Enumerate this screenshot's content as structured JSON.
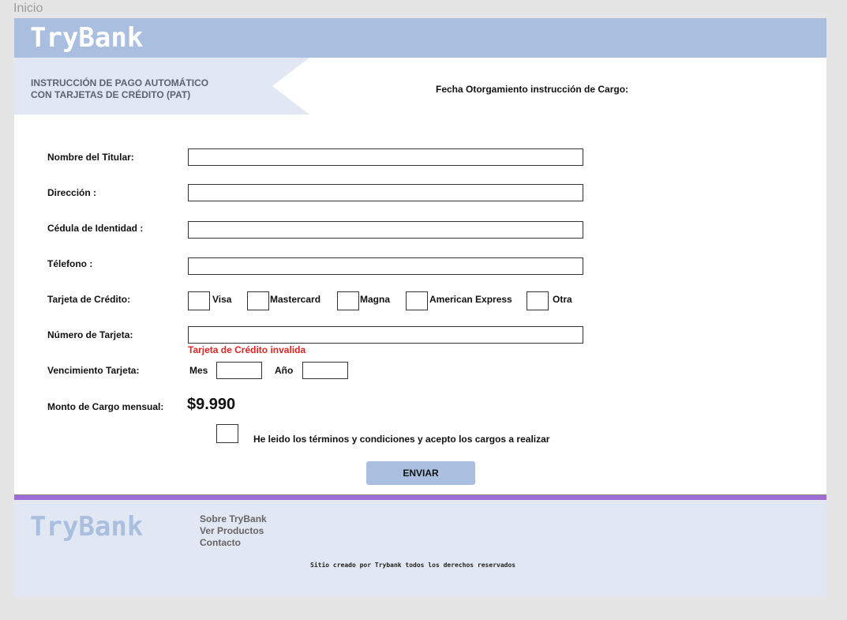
{
  "page_label": "Inicio",
  "header": {
    "logo": "TryBank"
  },
  "banner": {
    "title_line1": "INSTRUCCIÓN DE PAGO AUTOMÁTICO",
    "title_line2": "CON TARJETAS DE CRÉDITO (PAT)"
  },
  "fecha_label": "Fecha Otorgamiento instrucción de Cargo:",
  "form": {
    "nombre_label": "Nombre del Titular:",
    "nombre_value": "",
    "direccion_label": "Dirección :",
    "direccion_value": "",
    "cedula_label": "Cédula de Identidad :",
    "cedula_value": "",
    "telefono_label": "Télefono :",
    "telefono_value": "",
    "tarjeta_label": "Tarjeta de Crédito:",
    "card_options": [
      "Visa",
      "Mastercard",
      "Magna",
      "American Express",
      "Otra"
    ],
    "numero_label": "Número de Tarjeta:",
    "numero_value": "",
    "numero_error": "Tarjeta de Crédito invalida",
    "vencimiento_label": "Vencimiento Tarjeta:",
    "mes_label": "Mes",
    "mes_value": "",
    "anio_label": "Año",
    "anio_value": "",
    "monto_label": "Monto de Cargo mensual:",
    "monto_value": "$9.990",
    "terms_label": "He leido los términos y condiciones y acepto los cargos a realizar",
    "submit_label": "ENVIAR"
  },
  "colors": {
    "header_bg": "#aabfe0",
    "banner_bg": "#e1e8f3",
    "error": "#e52222",
    "footer_accent": "#a06cd5",
    "footer_bg": "#e1e8f3"
  },
  "footer": {
    "logo": "TryBank",
    "links": [
      "Sobre TryBank",
      "Ver Productos",
      "Contacto"
    ],
    "copyright": "Sitio creado por Trybank todos los derechos reservados"
  }
}
